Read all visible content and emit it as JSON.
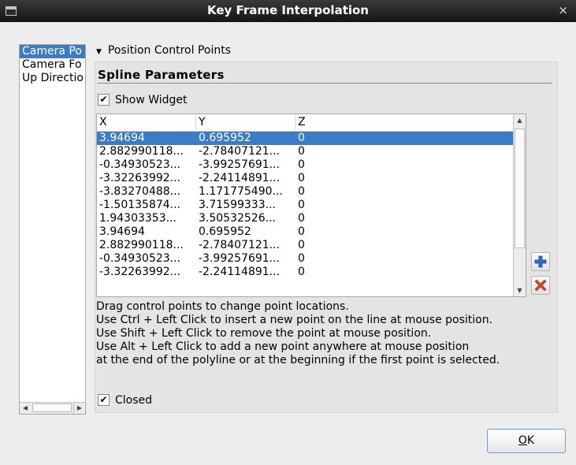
{
  "window": {
    "title": "Key Frame Interpolation",
    "close_glyph": "×",
    "icon": "window-menu-icon"
  },
  "sidebar": {
    "items": [
      {
        "label": "Camera Po",
        "selected": true
      },
      {
        "label": "Camera Fo",
        "selected": false
      },
      {
        "label": "Up Directio",
        "selected": false
      }
    ]
  },
  "section": {
    "toggle_glyph": "▼",
    "label": "Position Control Points"
  },
  "spline": {
    "title": "Spline Parameters",
    "show_widget": {
      "label": "Show Widget",
      "checked": true
    },
    "closed": {
      "label": "Closed",
      "checked": true
    }
  },
  "table": {
    "columns": [
      "X",
      "Y",
      "Z"
    ],
    "rows": [
      [
        "3.94694",
        "0.695952",
        "0"
      ],
      [
        "2.882990118...",
        "-2.78407121...",
        "0"
      ],
      [
        "-0.34930523...",
        "-3.99257691...",
        "0"
      ],
      [
        "-3.32263992...",
        "-2.24114891...",
        "0"
      ],
      [
        "-3.83270488...",
        "1.171775490...",
        "0"
      ],
      [
        "-1.50135874...",
        "3.71599333...",
        "0"
      ],
      [
        "1.94303353...",
        "3.50532526...",
        "0"
      ],
      [
        "3.94694",
        "0.695952",
        "0"
      ],
      [
        "2.882990118...",
        "-2.78407121...",
        "0"
      ],
      [
        "-0.34930523...",
        "-3.99257691...",
        "0"
      ],
      [
        "-3.32263992...",
        "-2.24114891...",
        "0"
      ]
    ],
    "selected_row": 0
  },
  "help": {
    "lines": [
      "Drag control points to change point locations.",
      "Use Ctrl + Left Click to insert a new point on the line at mouse position.",
      "Use Shift + Left Click to remove the point at mouse position.",
      "Use Alt + Left Click to add a new point anywhere at mouse position",
      "at the end of the polyline or at the beginning if the first point is selected."
    ]
  },
  "buttons": {
    "add_icon": "plus-icon",
    "remove_icon": "remove-x-icon",
    "ok_mnemonic": "O",
    "ok_rest": "K"
  },
  "colors": {
    "selection": "#3b7cc6",
    "add": "#2d6fc4",
    "remove": "#d9442c"
  },
  "check_glyph": "✔"
}
